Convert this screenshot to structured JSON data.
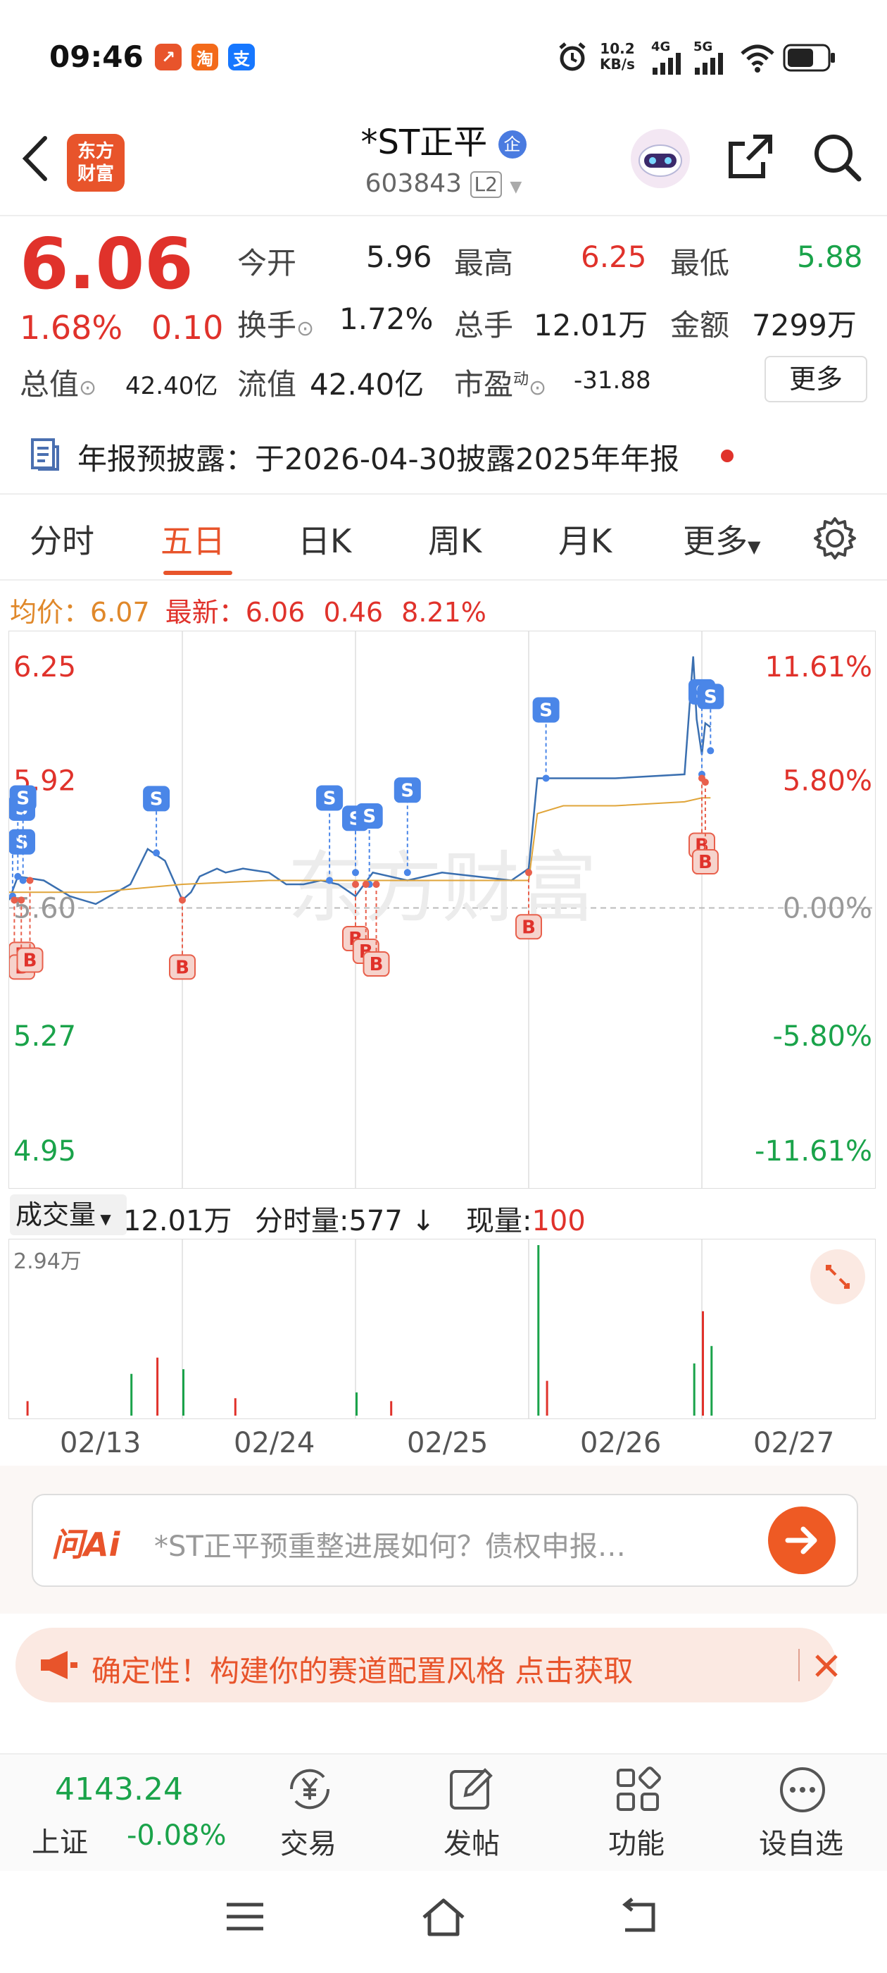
{
  "status_bar": {
    "time": "09:46",
    "app_badges": [
      {
        "text": "↗",
        "color": "#e8542b"
      },
      {
        "text": "淘",
        "color": "#f36a1a"
      },
      {
        "text": "支",
        "color": "#1677ff"
      }
    ],
    "net_speed_top": "10.2",
    "net_speed_bottom": "KB/s",
    "signal_1": "4G",
    "signal_2": "5G"
  },
  "header": {
    "logo_line1": "东方",
    "logo_line2": "财富",
    "title": "*ST正平",
    "title_badge": "企",
    "code": "603843",
    "level_badge": "L2"
  },
  "quote": {
    "price": "6.06",
    "change_pct": "1.68%",
    "change": "0.10",
    "open_label": "今开",
    "open": "5.96",
    "high_label": "最高",
    "high": "6.25",
    "low_label": "最低",
    "low": "5.88",
    "turnover_label": "换手",
    "turnover": "1.72%",
    "volume_label": "总手",
    "volume": "12.01万",
    "amount_label": "金额",
    "amount": "7299万",
    "mktcap_label": "总值",
    "mktcap": "42.40亿",
    "float_label": "流值",
    "float_cap": "42.40亿",
    "pe_label": "市盈",
    "pe_sup": "动",
    "pe": "-31.88",
    "more_button": "更多"
  },
  "notice": {
    "text": "年报预披露：于2026-04-30披露2025年年报"
  },
  "tabs": {
    "items": [
      "分时",
      "五日",
      "日K",
      "周K",
      "月K",
      "更多"
    ],
    "active": "五日"
  },
  "chart_info": {
    "avg_label": "均价：",
    "avg_value": "6.07",
    "latest_label": "最新：",
    "latest_value": "6.06",
    "latest_change": "0.46",
    "latest_pct": "8.21%"
  },
  "chart_data": {
    "type": "line",
    "y_ticks_left": [
      "6.25",
      "5.92",
      "5.60",
      "5.27",
      "4.95"
    ],
    "y_ticks_right": [
      "11.61%",
      "5.80%",
      "0.00%",
      "-5.80%",
      "-11.61%"
    ],
    "ylim": [
      4.95,
      6.25
    ],
    "x_days": [
      "02/13",
      "02/24",
      "02/25",
      "02/26",
      "02/27"
    ],
    "series": [
      {
        "color": "#3a6fb0",
        "x": [
          0.0,
          0.05,
          0.2,
          0.35,
          0.5,
          0.7,
          0.8,
          0.9,
          1.0,
          1.05,
          1.1,
          1.2,
          1.25,
          1.35,
          1.5,
          1.6,
          1.7,
          1.8,
          1.9,
          2.0,
          2.1,
          2.3,
          2.5,
          2.7,
          2.9,
          3.0,
          3.05,
          3.1,
          3.2,
          3.5,
          3.9,
          3.95,
          3.97,
          4.0,
          4.02,
          4.05
        ],
        "values": [
          5.62,
          5.68,
          5.67,
          5.63,
          5.61,
          5.66,
          5.75,
          5.72,
          5.62,
          5.64,
          5.68,
          5.7,
          5.69,
          5.7,
          5.69,
          5.66,
          5.66,
          5.67,
          5.66,
          5.63,
          5.69,
          5.67,
          5.69,
          5.68,
          5.67,
          5.7,
          5.93,
          5.93,
          5.93,
          5.93,
          5.94,
          6.24,
          6.08,
          5.99,
          6.07,
          6.06
        ]
      },
      {
        "color": "#e0a53a",
        "x": [
          0.0,
          0.5,
          1.0,
          1.5,
          2.0,
          2.5,
          3.0,
          3.05,
          3.2,
          3.5,
          3.9,
          4.0,
          4.05
        ],
        "values": [
          5.64,
          5.64,
          5.66,
          5.67,
          5.67,
          5.67,
          5.67,
          5.84,
          5.86,
          5.86,
          5.87,
          5.88,
          5.88
        ]
      }
    ],
    "markers": [
      {
        "label": "S",
        "day": 0.02,
        "price": 5.63
      },
      {
        "label": "S",
        "day": 0.05,
        "price": 5.68
      },
      {
        "label": "S",
        "day": 0.08,
        "price": 5.67
      },
      {
        "label": "B",
        "day": 0.03,
        "price": 5.62
      },
      {
        "label": "B",
        "day": 0.07,
        "price": 5.62
      },
      {
        "label": "B",
        "day": 0.12,
        "price": 5.67
      },
      {
        "label": "S",
        "day": 0.85,
        "price": 5.74
      },
      {
        "label": "B",
        "day": 1.0,
        "price": 5.62
      },
      {
        "label": "S",
        "day": 1.85,
        "price": 5.67
      },
      {
        "label": "S",
        "day": 2.0,
        "price": 5.69
      },
      {
        "label": "S",
        "day": 2.08,
        "price": 5.66
      },
      {
        "label": "S",
        "day": 2.3,
        "price": 5.69
      },
      {
        "label": "B",
        "day": 2.0,
        "price": 5.66
      },
      {
        "label": "B",
        "day": 2.06,
        "price": 5.66
      },
      {
        "label": "B",
        "day": 2.12,
        "price": 5.66
      },
      {
        "label": "B",
        "day": 3.0,
        "price": 5.69
      },
      {
        "label": "S",
        "day": 3.1,
        "price": 5.93
      },
      {
        "label": "S",
        "day": 4.0,
        "price": 5.94
      },
      {
        "label": "S",
        "day": 4.05,
        "price": 6.0
      },
      {
        "label": "B",
        "day": 4.0,
        "price": 5.93
      },
      {
        "label": "B",
        "day": 4.02,
        "price": 5.92
      }
    ],
    "volume": {
      "label": "成交量",
      "total": "12.01万",
      "tick_label": "分时量:",
      "tick_value": "577",
      "now_label": "现量:",
      "now_value": "100",
      "ymax_label": "2.94万",
      "ymax": 29400,
      "spikes": [
        {
          "day": 0.1,
          "v": 2500
        },
        {
          "day": 0.7,
          "v": 7200
        },
        {
          "day": 0.85,
          "v": 10000
        },
        {
          "day": 1.0,
          "v": 8000
        },
        {
          "day": 1.3,
          "v": 3000
        },
        {
          "day": 2.0,
          "v": 4000
        },
        {
          "day": 2.2,
          "v": 2500
        },
        {
          "day": 3.05,
          "v": 29400
        },
        {
          "day": 3.1,
          "v": 6000
        },
        {
          "day": 3.95,
          "v": 9000
        },
        {
          "day": 4.0,
          "v": 18000
        },
        {
          "day": 4.05,
          "v": 12000
        }
      ]
    }
  },
  "ask": {
    "brand": "问Ai",
    "placeholder": "*ST正平预重整进展如何？债权申报…"
  },
  "banner": {
    "text": "确定性！构建你的赛道配置风格 点击获取"
  },
  "bottom_nav": {
    "index_value": "4143.24",
    "index_name": "上证",
    "index_change": "-0.08%",
    "items": [
      "交易",
      "发帖",
      "功能",
      "设自选"
    ]
  }
}
